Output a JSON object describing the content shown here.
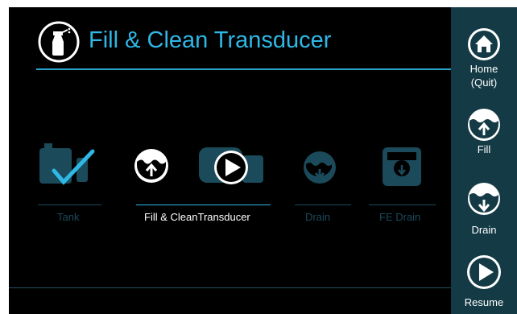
{
  "header": {
    "title": "Fill & Clean Transducer",
    "icon": "spray-bottle-icon"
  },
  "steps": [
    {
      "label": "Tank",
      "icon": "tank-check-icon",
      "state": "done"
    },
    {
      "label": "Fill & Clean Transducer",
      "label_part1": "Fill",
      "label_part2": "& Clean",
      "label_part3": "Transducer",
      "icon": "fill-arrow-icon",
      "state": "active"
    },
    {
      "label": "",
      "icon": "play-overlay-icon",
      "state": "active"
    },
    {
      "label": "Drain",
      "icon": "drain-arrow-icon",
      "state": "pending"
    },
    {
      "label": "FE Drain",
      "icon": "fe-drain-icon",
      "state": "pending"
    }
  ],
  "sidebar": {
    "home": {
      "label_line1": "Home",
      "label_line2": "(Quit)",
      "icon": "home-icon"
    },
    "fill": {
      "label": "Fill",
      "icon": "fill-arrow-icon"
    },
    "drain": {
      "label": "Drain",
      "icon": "drain-arrow-icon"
    },
    "resume": {
      "label": "Resume",
      "icon": "play-icon"
    }
  },
  "colors": {
    "accent": "#2fb7e6",
    "sidebar_bg": "#143a45",
    "dim": "#1b4a5a",
    "background": "#000000"
  }
}
